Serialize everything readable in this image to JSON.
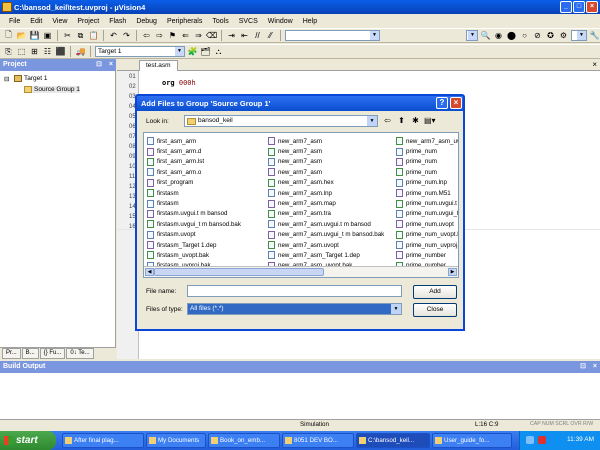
{
  "window": {
    "title": "C:\\bansod_keil\\test.uvproj - µVision4",
    "min": "_",
    "max": "□",
    "close": "×"
  },
  "menu": [
    "File",
    "Edit",
    "View",
    "Project",
    "Flash",
    "Debug",
    "Peripherals",
    "Tools",
    "SVCS",
    "Window",
    "Help"
  ],
  "toolbar": {
    "target": "Target 1"
  },
  "project": {
    "header": "Project",
    "root": "Target 1",
    "group": "Source Group 1",
    "tabs": [
      "Pr...",
      "B...",
      "{} Fu...",
      "0↓ Te..."
    ]
  },
  "editor": {
    "tab": "test.asm",
    "code_keyword": "org",
    "code_value": "000h",
    "line_numbers": [
      "01",
      "02",
      "03",
      "04",
      "05",
      "06",
      "07",
      "08",
      "09",
      "10",
      "11",
      "12",
      "13",
      "14",
      "15",
      "16"
    ]
  },
  "dialog": {
    "title": "Add Files to Group 'Source Group 1'",
    "help": "?",
    "close": "×",
    "look_in_label": "Look in:",
    "look_in_value": "bansod_keil",
    "columns": [
      [
        "first_asm_arm",
        "first_asm_arm.d",
        "first_asm_arm.lst",
        "first_asm_arm.o",
        "first_program",
        "firstasm",
        "firstasm",
        "firstasm.uvgui.t m bansod",
        "firstasm.uvgui_t m bansod.bak",
        "firstasm.uvopt",
        "firstasm_Target 1.dep",
        "firstasm_uvopt.bak",
        "firstasm_uvproj.bak"
      ],
      [
        "new_arm7_asm",
        "new_arm7_asm",
        "new_arm7_asm",
        "new_arm7_asm",
        "new_arm7_asm.hex",
        "new_arm7_asm.lnp",
        "new_arm7_asm.map",
        "new_arm7_asm.tra",
        "new_arm7_asm.uvgui.t m bansod",
        "new_arm7_asm.uvgui_t m bansod.bak",
        "new_arm7_asm.uvopt",
        "new_arm7_asm_Target 1.dep",
        "new_arm7_asm_uvopt.bak"
      ],
      [
        "new_arm7_asm_uv",
        "prime_num",
        "prime_num",
        "prime_num",
        "prime_num.lnp",
        "prime_num.M51",
        "prime_num.uvgui.t",
        "prime_num.uvgui_t",
        "prime_num.uvopt",
        "prime_num_uvopt.b",
        "prime_num_uvproj.b",
        "prime_number",
        "prime_number"
      ]
    ],
    "file_name_label": "File name:",
    "file_name_value": "",
    "files_of_type_label": "Files of type:",
    "files_of_type_value": "All files (*.*)",
    "add_button": "Add",
    "close_button": "Close"
  },
  "build": {
    "header": "Build Output"
  },
  "status": {
    "mode": "Simulation",
    "position": "L:16 C:9",
    "flags": "CAP  NUM  SCRL  OVR  R/W"
  },
  "taskbar": {
    "start": "start",
    "items": [
      "After final plag...",
      "My Documents",
      "Book_on_emb...",
      "8051 DEV BO...",
      "C:\\bansod_keil...",
      "User_guide_fo..."
    ],
    "clock": "11:39 AM"
  },
  "colors": {
    "titlebar": "#0a5ee8",
    "selection": "#316ac5",
    "taskbar": "#245edb",
    "start": "#3a953a"
  }
}
